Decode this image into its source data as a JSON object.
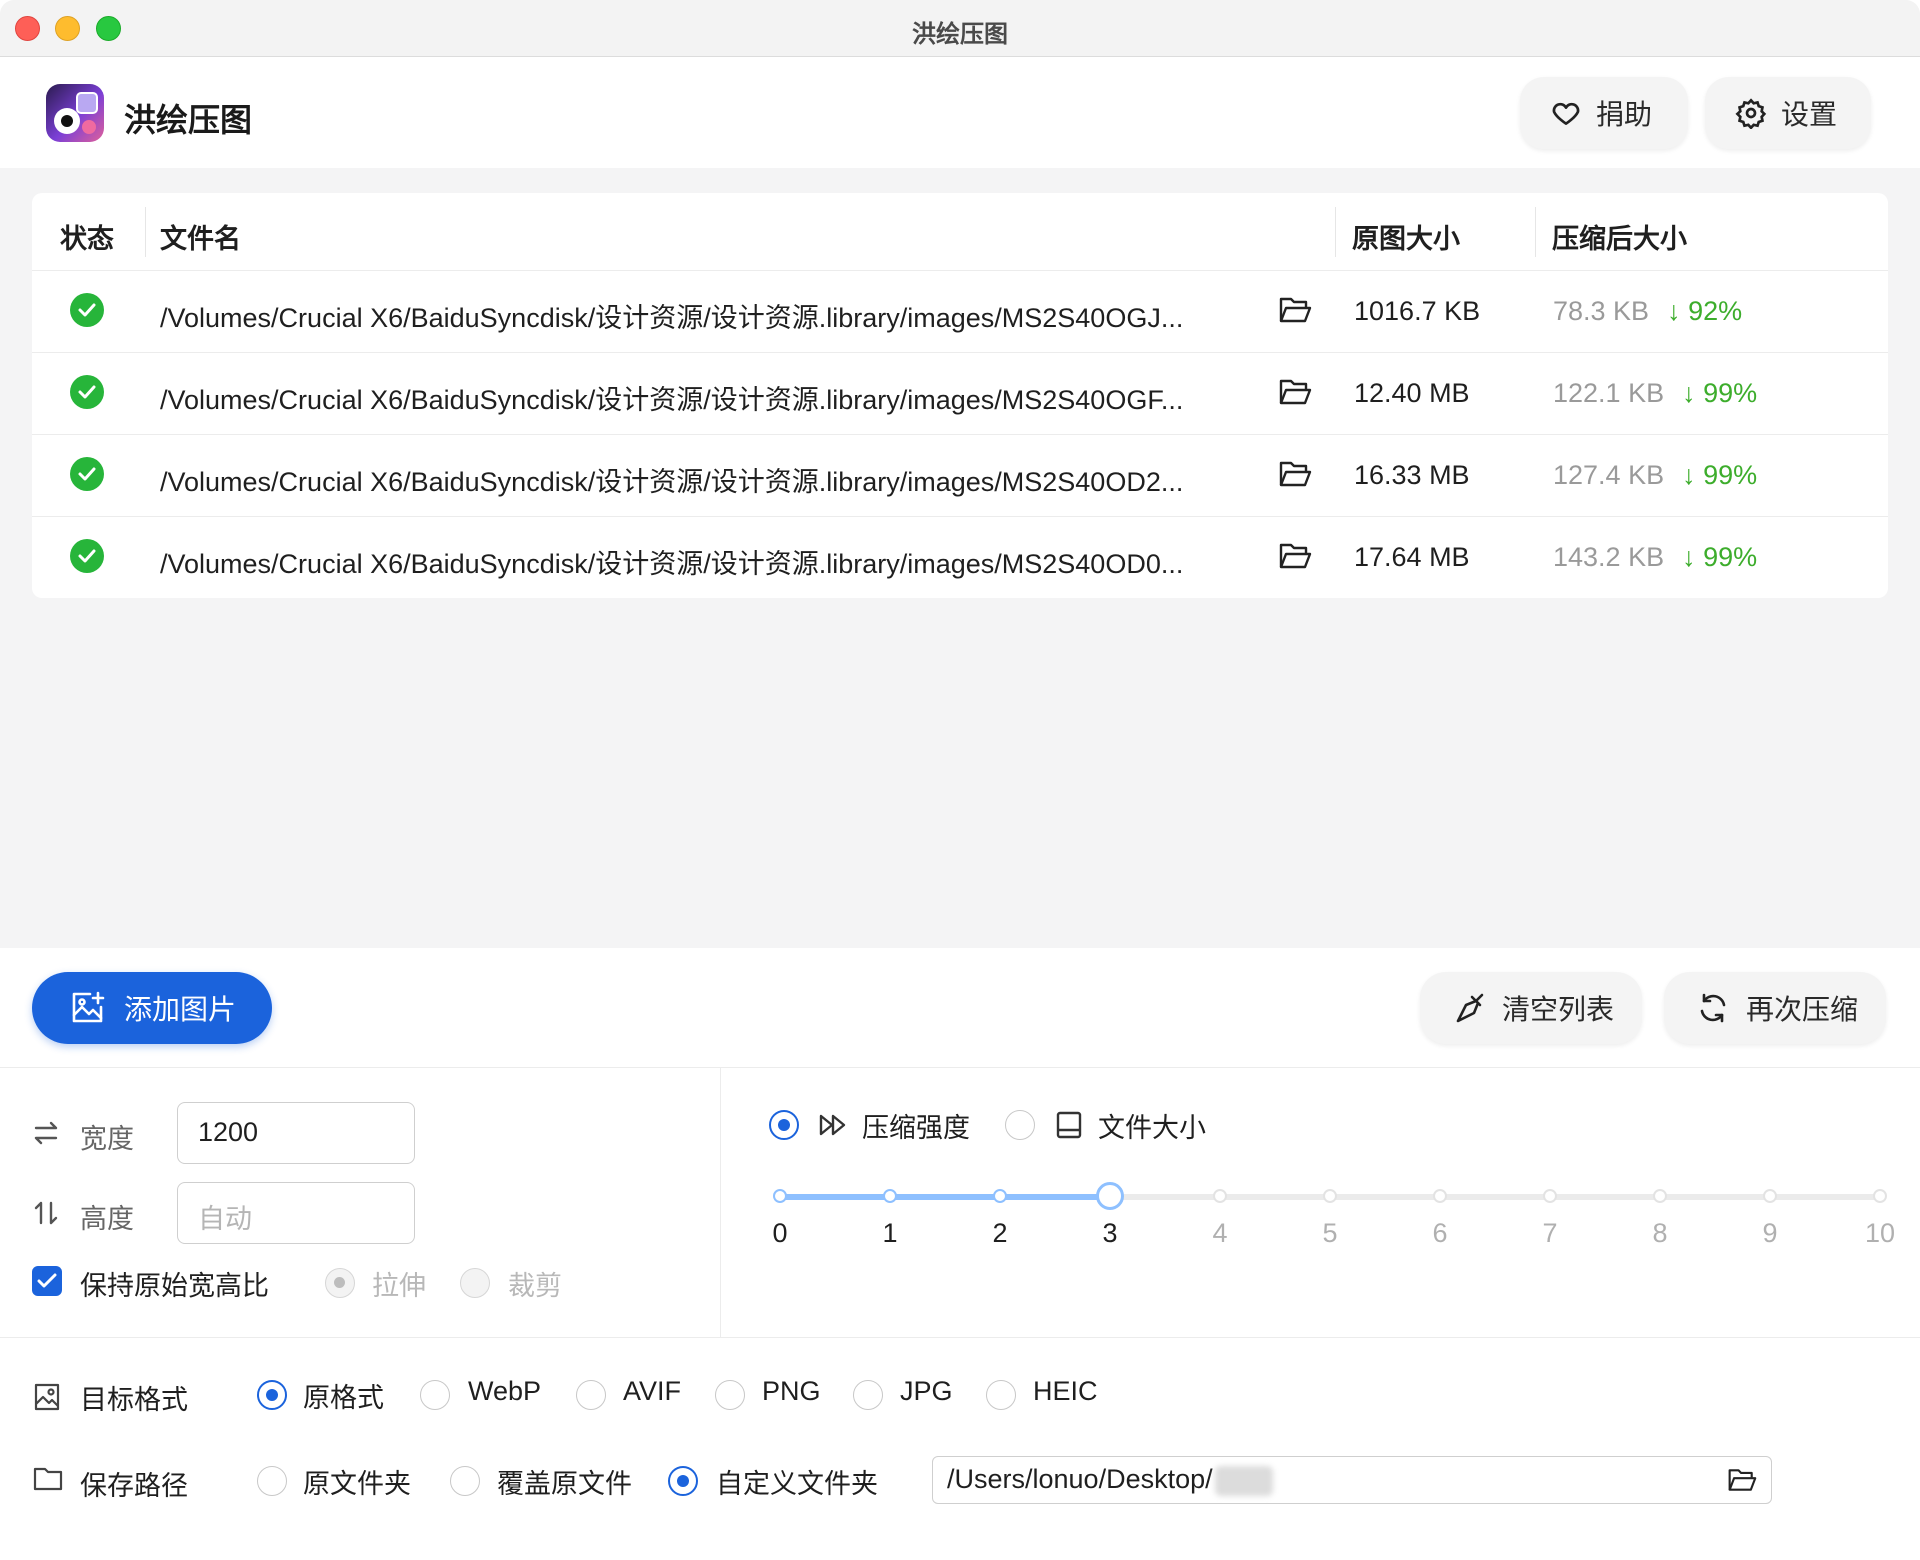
{
  "window": {
    "title": "洪绘压图"
  },
  "header": {
    "app_name": "洪绘压图",
    "donate_label": "捐助",
    "settings_label": "设置"
  },
  "table": {
    "columns": [
      "状态",
      "文件名",
      "原图大小",
      "压缩后大小"
    ],
    "rows": [
      {
        "name": "/Volumes/Crucial X6/BaiduSyncdisk/设计资源/设计资源.library/images/MS2S40OGJ...",
        "orig": "1016.7 KB",
        "after": "78.3 KB",
        "pct": "↓ 92%"
      },
      {
        "name": "/Volumes/Crucial X6/BaiduSyncdisk/设计资源/设计资源.library/images/MS2S40OGF...",
        "orig": "12.40 MB",
        "after": "122.1 KB",
        "pct": "↓ 99%"
      },
      {
        "name": "/Volumes/Crucial X6/BaiduSyncdisk/设计资源/设计资源.library/images/MS2S40OD2...",
        "orig": "16.33 MB",
        "after": "127.4 KB",
        "pct": "↓ 99%"
      },
      {
        "name": "/Volumes/Crucial X6/BaiduSyncdisk/设计资源/设计资源.library/images/MS2S40OD0...",
        "orig": "17.64 MB",
        "after": "143.2 KB",
        "pct": "↓ 99%"
      }
    ]
  },
  "actions": {
    "add_label": "添加图片",
    "clear_label": "清空列表",
    "again_label": "再次压缩"
  },
  "dimensions": {
    "width_label": "宽度",
    "width_value": "1200",
    "height_label": "高度",
    "height_placeholder": "自动",
    "keep_ratio_label": "保持原始宽高比",
    "stretch_label": "拉伸",
    "crop_label": "裁剪"
  },
  "compression": {
    "mode_strength_label": "压缩强度",
    "mode_size_label": "文件大小",
    "ticks": [
      "0",
      "1",
      "2",
      "3",
      "4",
      "5",
      "6",
      "7",
      "8",
      "9",
      "10"
    ],
    "level": 3
  },
  "format": {
    "label": "目标格式",
    "options": [
      "原格式",
      "WebP",
      "AVIF",
      "PNG",
      "JPG",
      "HEIC"
    ],
    "selected": "原格式"
  },
  "save": {
    "label": "保存路径",
    "options": [
      "原文件夹",
      "覆盖原文件",
      "自定义文件夹"
    ],
    "selected": "自定义文件夹",
    "path": "/Users/lonuo/Desktop/"
  },
  "colors": {
    "accent": "#1b63dc",
    "success": "#27b53a",
    "slider": "#8ec0ff"
  }
}
